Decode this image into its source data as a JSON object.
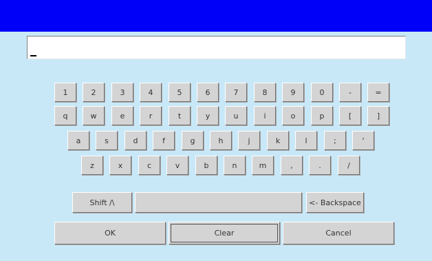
{
  "input": {
    "value": ""
  },
  "keyboard": {
    "row1": [
      "1",
      "2",
      "3",
      "4",
      "5",
      "6",
      "7",
      "8",
      "9",
      "0",
      "-",
      "="
    ],
    "row2": [
      "q",
      "w",
      "e",
      "r",
      "t",
      "y",
      "u",
      "i",
      "o",
      "p",
      "[",
      "]"
    ],
    "row3": [
      "a",
      "s",
      "d",
      "f",
      "g",
      "h",
      "j",
      "k",
      "l",
      ";",
      "'"
    ],
    "row4": [
      "z",
      "x",
      "c",
      "v",
      "b",
      "n",
      "m",
      ",",
      ".",
      "/"
    ],
    "shift_label": "Shift /\\",
    "space_label": "",
    "backspace_label": "<- Backspace"
  },
  "actions": {
    "ok_label": "OK",
    "clear_label": "Clear",
    "cancel_label": "Cancel"
  }
}
